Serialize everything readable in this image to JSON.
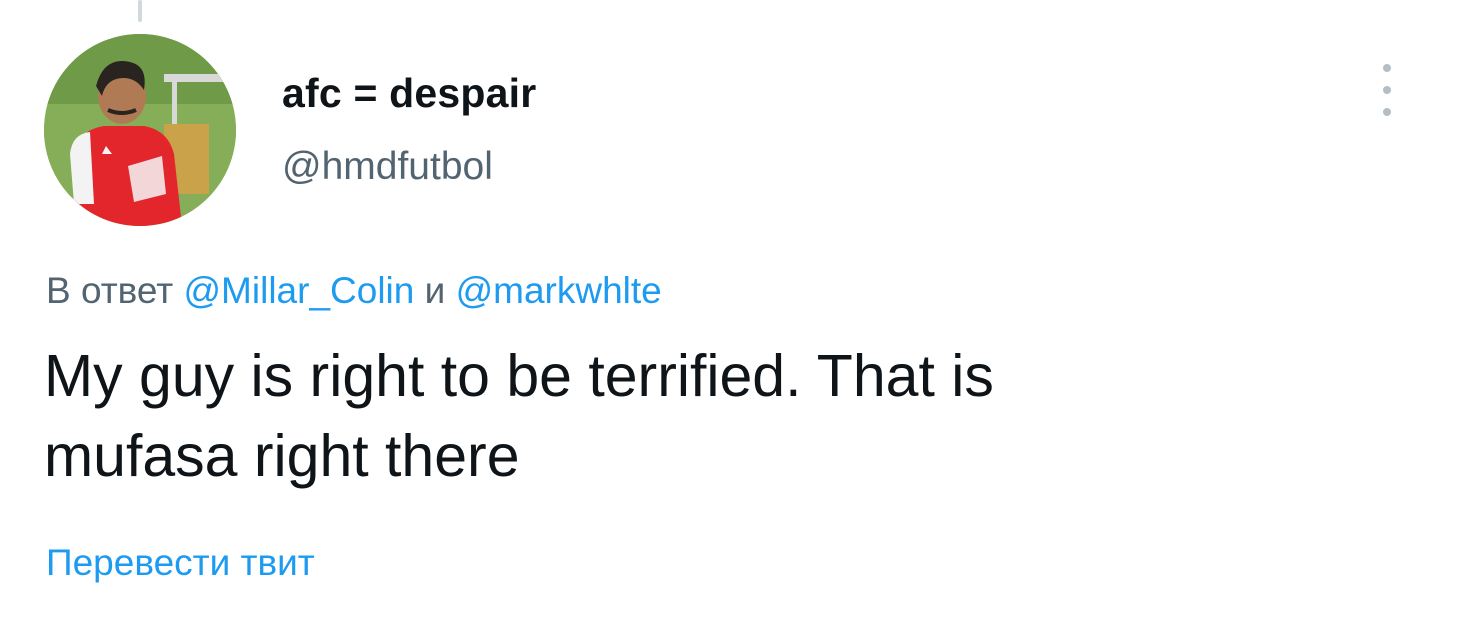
{
  "tweet": {
    "author": {
      "display_name": "afc = despair",
      "handle": "@hmdfutbol",
      "avatar_icon": "avatar-photo"
    },
    "more_icon": "more-vertical-icon",
    "reply_to": {
      "prefix": "В ответ",
      "mentions": [
        "@Millar_Colin",
        "@markwhlte"
      ],
      "conjunction": "и"
    },
    "text_lines": [
      "My guy is right to be terrified. That is",
      "mufasa right there"
    ],
    "translate_label": "Перевести твит"
  },
  "colors": {
    "text_primary": "#0f1419",
    "text_secondary": "#536471",
    "link": "#1d9bf0",
    "thread_line": "#cfd9de"
  }
}
